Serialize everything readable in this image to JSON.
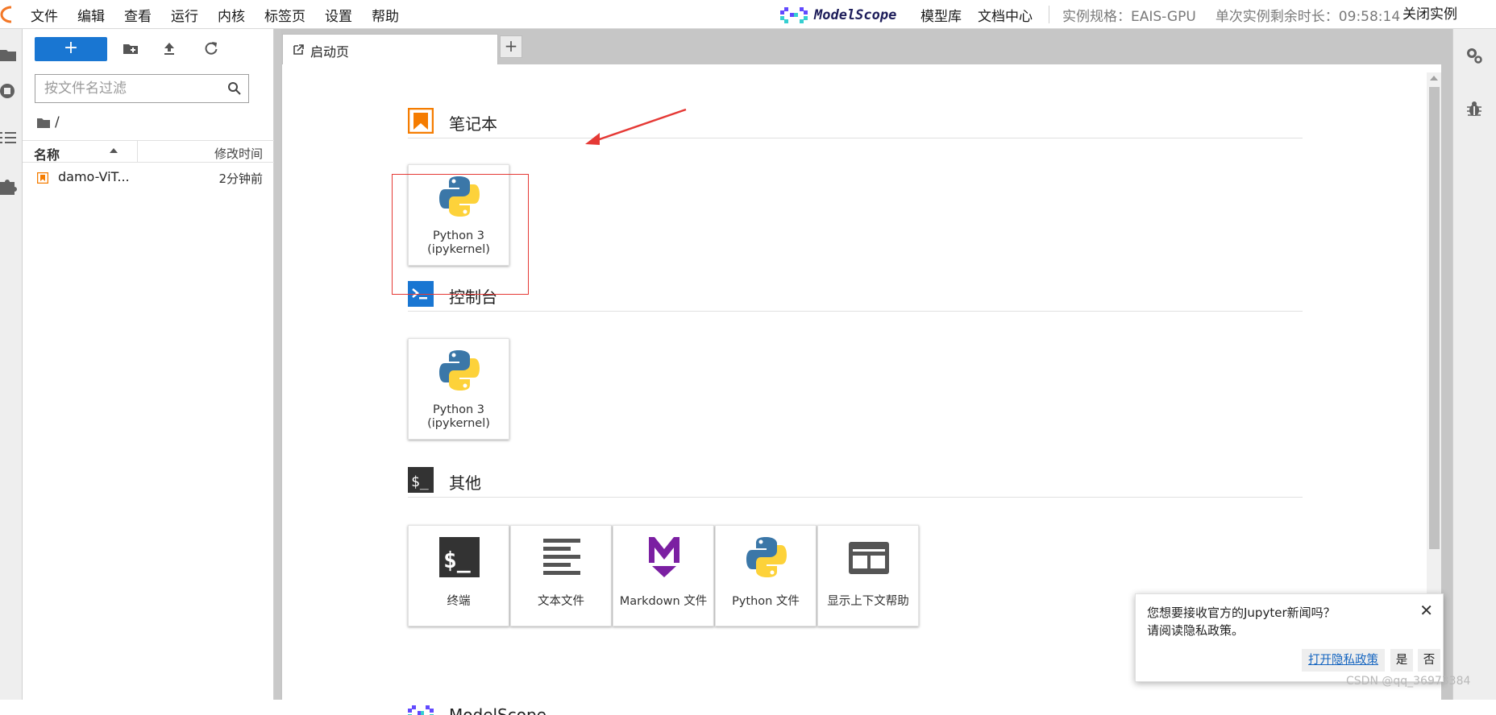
{
  "menu": [
    "文件",
    "编辑",
    "查看",
    "运行",
    "内核",
    "标签页",
    "设置",
    "帮助"
  ],
  "brand": {
    "name": "ModelScope"
  },
  "top_links": [
    "模型库",
    "文档中心"
  ],
  "instance": {
    "spec": "实例规格：EAIS-GPU",
    "time_left": "单次实例剩余时长：09:58:14",
    "close": "关闭实例"
  },
  "filebrowser": {
    "new_label": "+",
    "filter_placeholder": "按文件名过滤",
    "path": "/",
    "col_name": "名称",
    "col_modified": "修改时间",
    "files": [
      {
        "name": "damo-ViT...",
        "modified": "2分钟前"
      }
    ]
  },
  "tabs": {
    "launcher_label": "启动页",
    "add_label": "+"
  },
  "launcher": {
    "notebook": {
      "title": "笔记本",
      "card": "Python 3 (ipykernel)",
      "card_line1": "Python 3",
      "card_line2": "(ipykernel)"
    },
    "console": {
      "title": "控制台",
      "card_line1": "Python 3",
      "card_line2": "(ipykernel)"
    },
    "other": {
      "title": "其他",
      "cards": [
        "终端",
        "文本文件",
        "Markdown 文件",
        "Python 文件",
        "显示上下文帮助"
      ]
    },
    "modelscope": {
      "title": "ModelScope"
    }
  },
  "toast": {
    "line1": "您想要接收官方的Jupyter新闻吗？",
    "line2": "请阅读隐私政策。",
    "privacy": "打开隐私政策",
    "yes": "是",
    "no": "否",
    "close": "✕"
  },
  "watermark": "CSDN @qq_36973384",
  "colors": {
    "accent": "#1976d2",
    "notebook_orange": "#f57c00",
    "console_blue": "#1976d2",
    "annotation_red": "#e53935"
  }
}
